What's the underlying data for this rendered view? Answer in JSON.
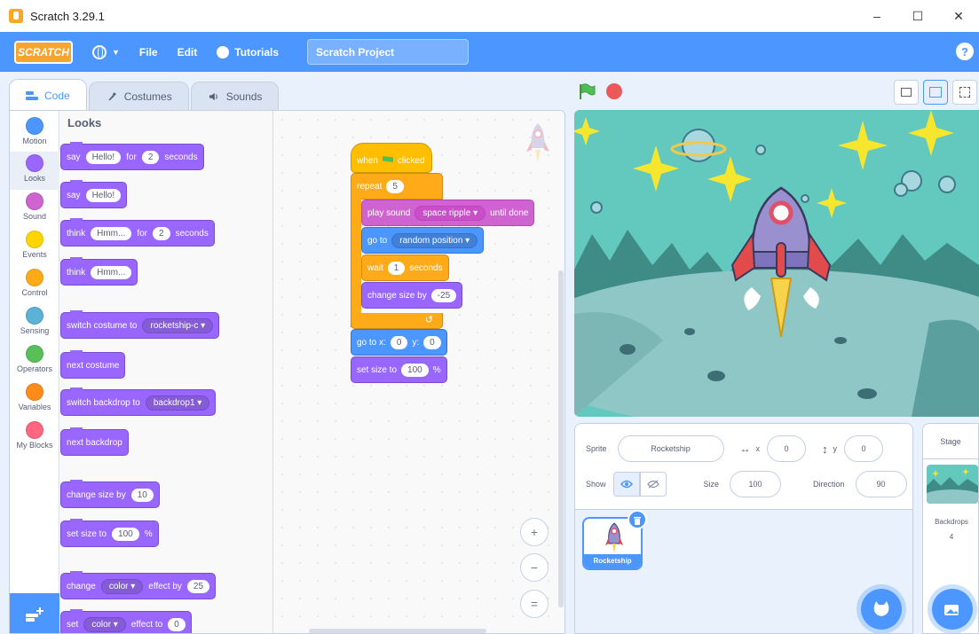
{
  "window": {
    "title": "Scratch 3.29.1",
    "minimize": "–",
    "maximize": "☐",
    "close": "✕"
  },
  "menubar": {
    "logo": "SCRATCH",
    "file": "File",
    "edit": "Edit",
    "tutorials": "Tutorials",
    "project_title": "Scratch Project",
    "help": "?"
  },
  "tabs": [
    {
      "label": "Code"
    },
    {
      "label": "Costumes"
    },
    {
      "label": "Sounds"
    }
  ],
  "categories": [
    {
      "label": "Motion",
      "color": "#4c97ff"
    },
    {
      "label": "Looks",
      "color": "#9966ff"
    },
    {
      "label": "Sound",
      "color": "#cf63cf"
    },
    {
      "label": "Events",
      "color": "#ffd500"
    },
    {
      "label": "Control",
      "color": "#ffab19"
    },
    {
      "label": "Sensing",
      "color": "#5cb1d6"
    },
    {
      "label": "Operators",
      "color": "#59c059"
    },
    {
      "label": "Variables",
      "color": "#ff8c1a"
    },
    {
      "label": "My Blocks",
      "color": "#ff6680"
    }
  ],
  "palette": {
    "title": "Looks",
    "say_secs": {
      "say": "say",
      "msg": "Hello!",
      "for": "for",
      "secs": "2",
      "seconds": "seconds"
    },
    "say": {
      "say": "say",
      "msg": "Hello!"
    },
    "think_secs": {
      "think": "think",
      "msg": "Hmm...",
      "for": "for",
      "secs": "2",
      "seconds": "seconds"
    },
    "think": {
      "think": "think",
      "msg": "Hmm..."
    },
    "switch_costume": {
      "label": "switch costume to",
      "value": "rocketship-c ▾"
    },
    "next_costume": "next costume",
    "switch_backdrop": {
      "label": "switch backdrop to",
      "value": "backdrop1 ▾"
    },
    "next_backdrop": "next backdrop",
    "change_size": {
      "label": "change size by",
      "value": "10"
    },
    "set_size": {
      "label": "set size to",
      "value": "100",
      "unit": "%"
    },
    "change_effect": {
      "change": "change",
      "effect": "color ▾",
      "by": "effect by",
      "value": "25"
    },
    "set_effect": {
      "set": "set",
      "effect": "color ▾",
      "to": "effect to",
      "value": "0"
    }
  },
  "script": {
    "hat": {
      "when": "when",
      "clicked": "clicked"
    },
    "repeat": {
      "label": "repeat",
      "value": "5"
    },
    "play_sound": {
      "label": "play sound",
      "value": "space ripple ▾",
      "suffix": "until done"
    },
    "go_to": {
      "label": "go to",
      "value": "random position ▾"
    },
    "wait": {
      "label": "wait",
      "value": "1",
      "suffix": "seconds"
    },
    "change_size": {
      "label": "change size by",
      "value": "-25"
    },
    "repeat_arrow": "↺",
    "go_to_xy": {
      "label": "go to x:",
      "x": "0",
      "y_label": "y:",
      "y": "0"
    },
    "set_size": {
      "label": "set size to",
      "value": "100",
      "unit": "%"
    },
    "zoom_in": "+",
    "zoom_out": "−",
    "zoom_reset": "="
  },
  "sprite_info": {
    "sprite_label": "Sprite",
    "sprite_name": "Rocketship",
    "x_arrow": "↔",
    "x_label": "x",
    "x_value": "0",
    "y_arrow": "↕",
    "y_label": "y",
    "y_value": "0",
    "show_label": "Show",
    "size_label": "Size",
    "size_value": "100",
    "direction_label": "Direction",
    "direction_value": "90"
  },
  "sprite_list": [
    {
      "name": "Rocketship"
    }
  ],
  "stage_pane": {
    "title": "Stage",
    "backdrops_label": "Backdrops",
    "backdrops_count": "4"
  }
}
